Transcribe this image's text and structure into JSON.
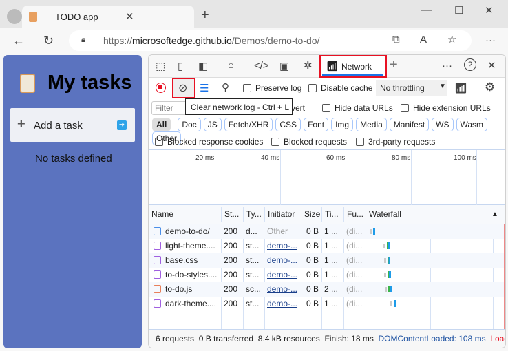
{
  "browser": {
    "tab_title": "TODO app",
    "url_prefix": "https://",
    "url_host": "microsoftedge.github.io",
    "url_path": "/Demos/demo-to-do/"
  },
  "app": {
    "title": "My tasks",
    "add_task": "Add a task",
    "empty": "No tasks defined"
  },
  "devtools": {
    "network_tab": "Network",
    "preserve_log": "Preserve log",
    "disable_cache": "Disable cache",
    "throttling": "No throttling",
    "filter_placeholder": "Filter",
    "invert": "vert",
    "hide_data_urls": "Hide data URLs",
    "hide_ext_urls": "Hide extension URLs",
    "tooltip": "Clear network log - Ctrl + L",
    "types": [
      "All",
      "Doc",
      "JS",
      "Fetch/XHR",
      "CSS",
      "Font",
      "Img",
      "Media",
      "Manifest",
      "WS",
      "Wasm",
      "Other"
    ],
    "blocked_cookies": "Blocked response cookies",
    "blocked_requests": "Blocked requests",
    "third_party": "3rd-party requests",
    "ticks": [
      "20 ms",
      "40 ms",
      "60 ms",
      "80 ms",
      "100 ms"
    ],
    "columns": [
      "Name",
      "St...",
      "Ty...",
      "Initiator",
      "Size",
      "Ti...",
      "Fu...",
      "Waterfall"
    ],
    "rows": [
      {
        "name": "demo-to-do/",
        "icon": "document-icon",
        "status": "200",
        "type": "d...",
        "initiator": "Other",
        "size": "0 B",
        "time": "1 ...",
        "fulfilled": "(di..."
      },
      {
        "name": "light-theme....",
        "icon": "stylesheet-icon",
        "status": "200",
        "type": "st...",
        "initiator": "demo-...",
        "size": "0 B",
        "time": "1 ...",
        "fulfilled": "(di..."
      },
      {
        "name": "base.css",
        "icon": "stylesheet-icon",
        "status": "200",
        "type": "st...",
        "initiator": "demo-...",
        "size": "0 B",
        "time": "1 ...",
        "fulfilled": "(di..."
      },
      {
        "name": "to-do-styles....",
        "icon": "stylesheet-icon",
        "status": "200",
        "type": "st...",
        "initiator": "demo-...",
        "size": "0 B",
        "time": "1 ...",
        "fulfilled": "(di..."
      },
      {
        "name": "to-do.js",
        "icon": "script-icon",
        "status": "200",
        "type": "sc...",
        "initiator": "demo-...",
        "size": "0 B",
        "time": "2 ...",
        "fulfilled": "(di..."
      },
      {
        "name": "dark-theme....",
        "icon": "stylesheet-icon",
        "status": "200",
        "type": "st...",
        "initiator": "demo-...",
        "size": "0 B",
        "time": "1 ...",
        "fulfilled": "(di..."
      }
    ],
    "footer": {
      "requests": "6 requests",
      "transferred": "0 B transferred",
      "resources": "8.4 kB resources",
      "finish": "Finish: 18 ms",
      "dcl": "DOMContentLoaded: 108 ms",
      "load": "Load:"
    }
  },
  "colors": {
    "app_bg": "#5b73bf",
    "highlight": "#e81123",
    "accent": "#1a73e8",
    "dcl": "#1a4fa0",
    "load": "#e81123"
  }
}
